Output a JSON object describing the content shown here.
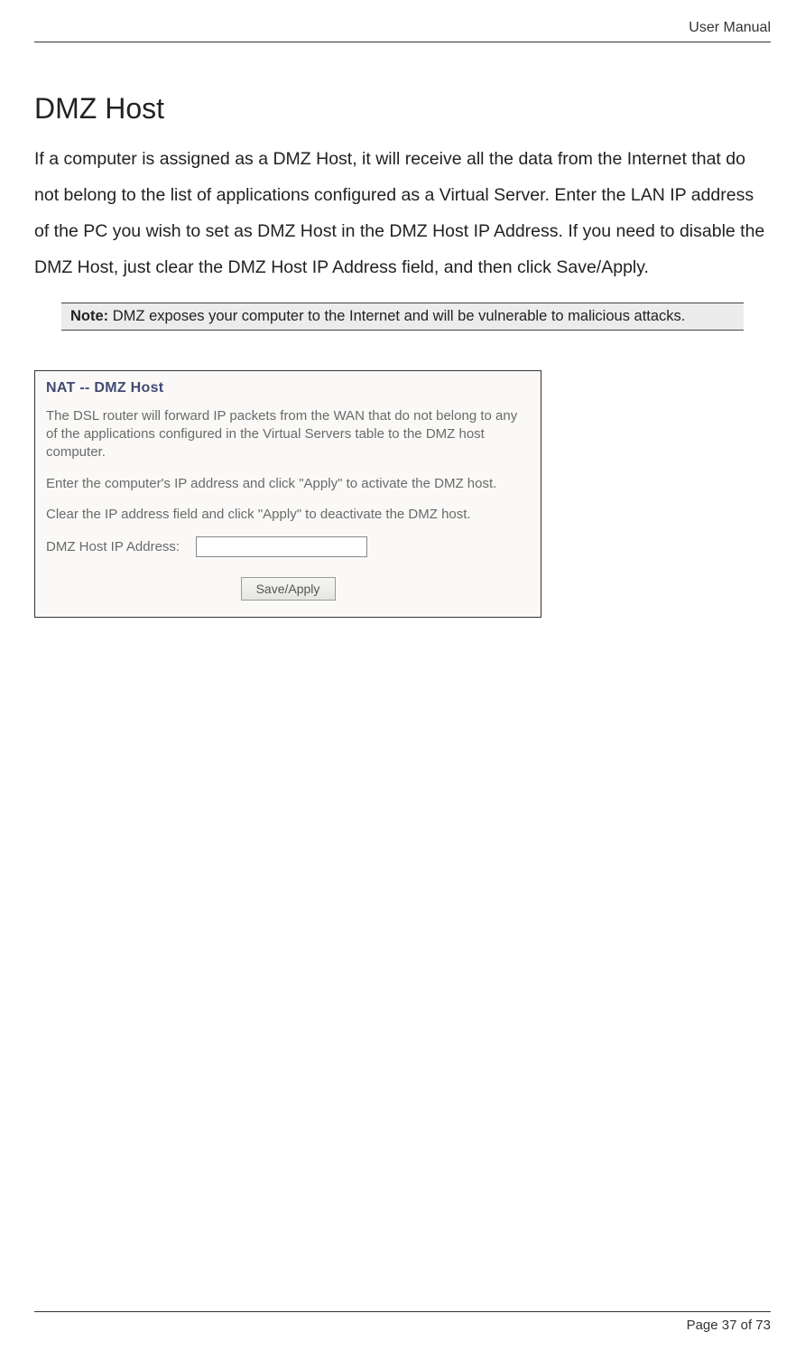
{
  "header": {
    "title": "User Manual"
  },
  "section": {
    "title": "DMZ Host",
    "paragraph": "If a computer is assigned as a DMZ Host, it will receive all the data from the Internet that do not belong to the list of applications configured as a Virtual Server. Enter the LAN IP address of the PC you wish to set as DMZ Host in the DMZ Host IP Address. If you need to disable the DMZ Host, just clear the DMZ Host IP Address field, and then click Save/Apply."
  },
  "note": {
    "label": "Note:",
    "text": " DMZ exposes your computer to the Internet and will be vulnerable to malicious attacks."
  },
  "panel": {
    "title": "NAT -- DMZ Host",
    "para1": "The DSL router will forward IP packets from the WAN that do not belong to any of the applications configured in the Virtual Servers table to the DMZ host computer.",
    "para2": "Enter the computer's IP address and click \"Apply\" to activate the DMZ host.",
    "para3": "Clear the IP address field and click \"Apply\" to deactivate the DMZ host.",
    "ip_label": "DMZ Host IP Address:",
    "ip_value": "",
    "save_label": "Save/Apply"
  },
  "footer": {
    "text": "Page 37 of 73"
  }
}
